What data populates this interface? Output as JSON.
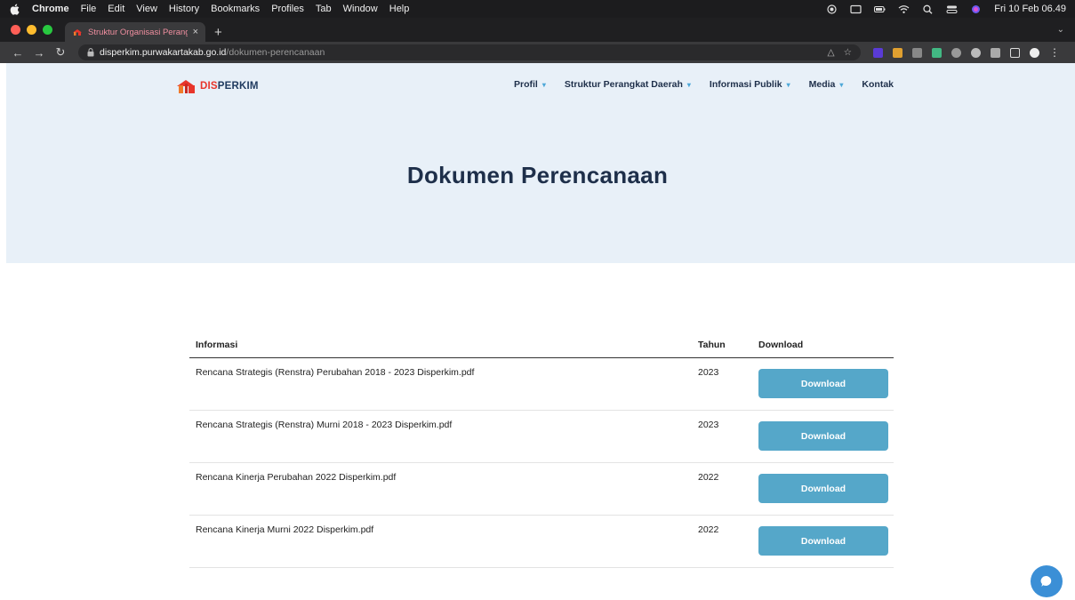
{
  "menubar": {
    "app": "Chrome",
    "items": [
      "File",
      "Edit",
      "View",
      "History",
      "Bookmarks",
      "Profiles",
      "Tab",
      "Window",
      "Help"
    ],
    "clock": "Fri 10 Feb 06.49"
  },
  "browser": {
    "tab_title": "Struktur Organisasi Perangkat",
    "tab_close": "×",
    "new_tab": "+",
    "url_host": "disperkim.purwakartakab.go.id",
    "url_path": "/dokumen-perencanaan"
  },
  "site": {
    "brand_dis": "DIS",
    "brand_perkim": "PERKIM",
    "nav": [
      {
        "label": "Profil",
        "caret": "▾"
      },
      {
        "label": "Struktur Perangkat Daerah",
        "caret": "▾"
      },
      {
        "label": "Informasi Publik",
        "caret": "▾"
      },
      {
        "label": "Media",
        "caret": "▾"
      },
      {
        "label": "Kontak",
        "caret": ""
      }
    ],
    "page_title": "Dokumen Perencanaan"
  },
  "table": {
    "headers": {
      "info": "Informasi",
      "year": "Tahun",
      "download": "Download"
    },
    "rows": [
      {
        "info": "Rencana Strategis (Renstra) Perubahan 2018 - 2023 Disperkim.pdf",
        "year": "2023",
        "button": "Download"
      },
      {
        "info": "Rencana Strategis (Renstra) Murni 2018 - 2023 Disperkim.pdf",
        "year": "2023",
        "button": "Download"
      },
      {
        "info": "Rencana Kinerja Perubahan 2022 Disperkim.pdf",
        "year": "2022",
        "button": "Download"
      },
      {
        "info": "Rencana Kinerja Murni 2022 Disperkim.pdf",
        "year": "2022",
        "button": "Download"
      }
    ]
  },
  "colors": {
    "accent": "#55a7c9",
    "hero_bg": "#e8f0f8",
    "brand_red": "#e8352b",
    "brand_navy": "#1f3a5f"
  }
}
